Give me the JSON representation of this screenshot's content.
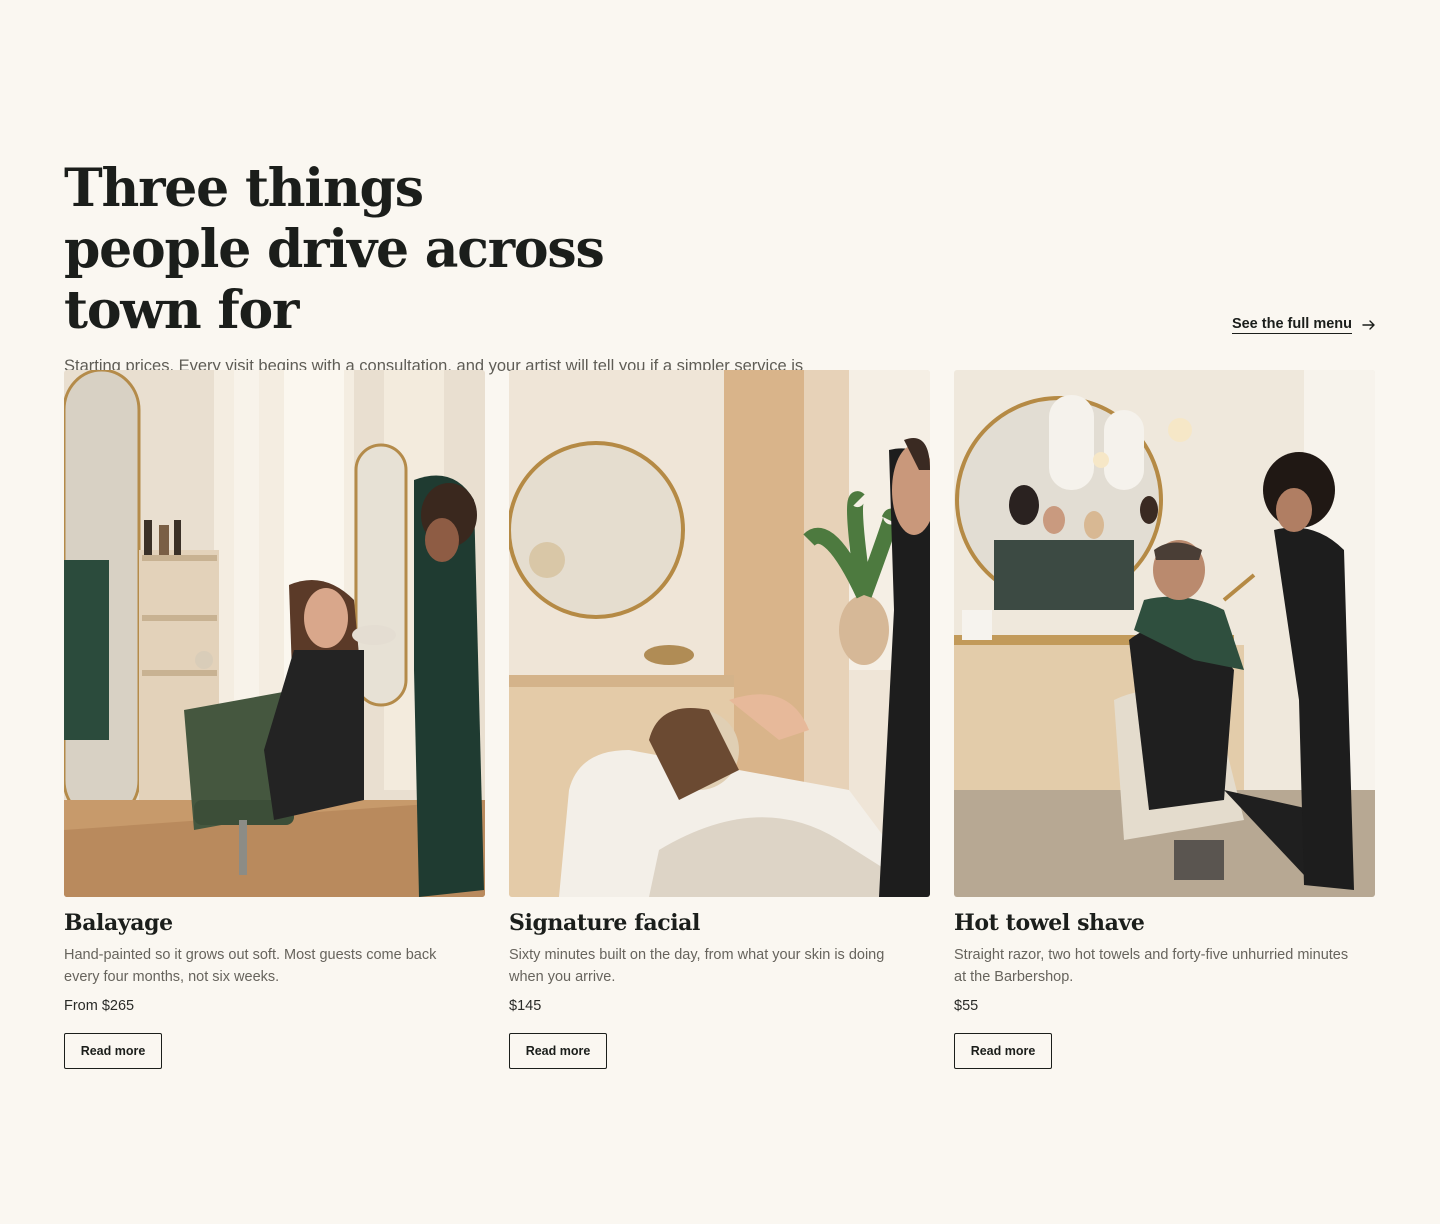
{
  "section": {
    "headline": "Three things people drive across town for",
    "intro": "Starting prices. Every visit begins with a consultation, and your artist will tell you if a simpler service is the right one.",
    "menu_link": {
      "label": "See the full menu",
      "icon": "arrow-right-icon"
    }
  },
  "cards": [
    {
      "title": "Balayage",
      "description": "Hand-painted so it grows out soft. Most guests come back every four months, not six weeks.",
      "price": "From $265",
      "button": "Read more"
    },
    {
      "title": "Signature facial",
      "description": "Sixty minutes built on the day, from what your skin is doing when you arrive.",
      "price": "$145",
      "button": "Read more"
    },
    {
      "title": "Hot towel shave",
      "description": "Straight razor, two hot towels and forty-five unhurried minutes at the Barbershop.",
      "price": "$55",
      "button": "Read more"
    }
  ],
  "colors": {
    "background": "#faf7f1",
    "text": "#1b1e1b",
    "muted": "#67645d",
    "accent_green": "#3e5a3c"
  }
}
